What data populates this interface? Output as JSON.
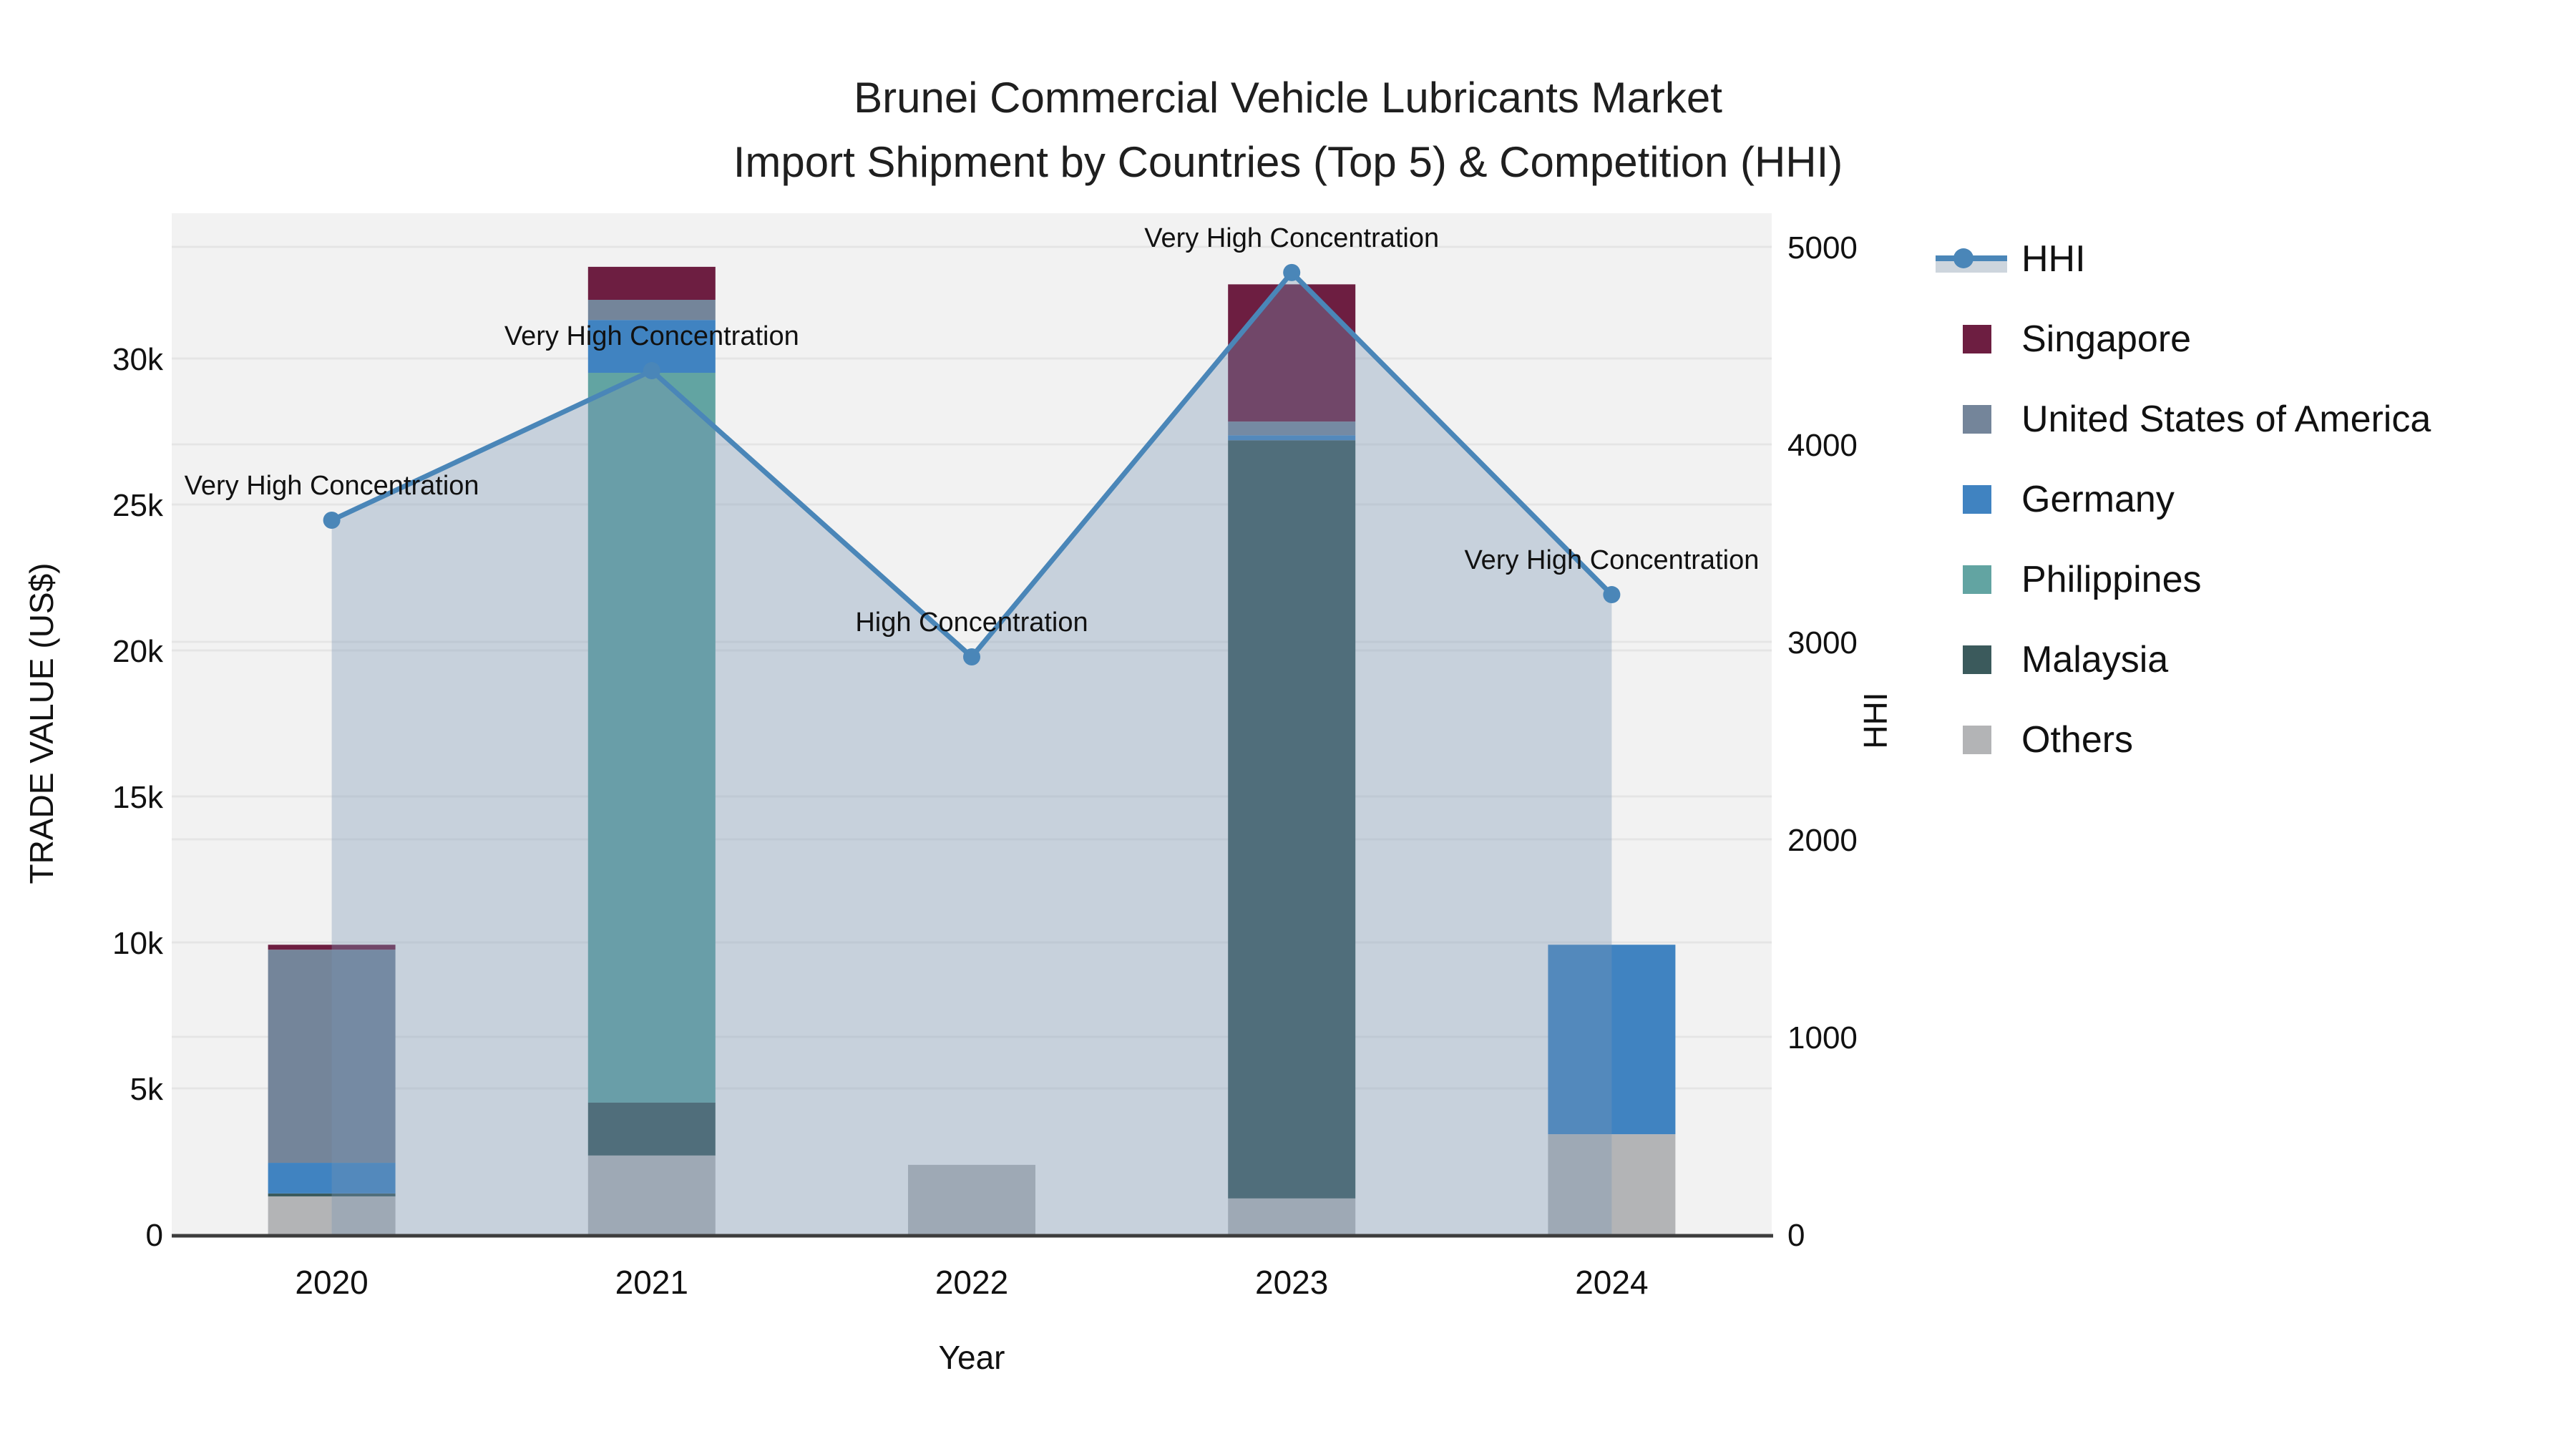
{
  "title": {
    "line1": "Brunei Commercial Vehicle Lubricants Market",
    "line2": "Import Shipment by Countries (Top 5) & Competition (HHI)"
  },
  "axes": {
    "x_title": "Year",
    "y_left_title": "TRADE VALUE (US$)",
    "y_right_title": "HHI",
    "x_tick_labels": [
      "2020",
      "2021",
      "2022",
      "2023",
      "2024"
    ],
    "y_left_tick_labels": [
      "0",
      "5k",
      "10k",
      "15k",
      "20k",
      "25k",
      "30k"
    ],
    "y_left_tick_values": [
      0,
      5000,
      10000,
      15000,
      20000,
      25000,
      30000
    ],
    "y_right_tick_labels": [
      "0",
      "1000",
      "2000",
      "3000",
      "4000",
      "5000"
    ],
    "y_right_tick_values": [
      0,
      1000,
      2000,
      3000,
      4000,
      5000
    ]
  },
  "legend": {
    "items": [
      {
        "label": "HHI",
        "type": "line",
        "color": "#4a86b8"
      },
      {
        "label": "Singapore",
        "type": "swatch",
        "color": "#6d1e41"
      },
      {
        "label": "United States of America",
        "type": "swatch",
        "color": "#74859a"
      },
      {
        "label": "Germany",
        "type": "swatch",
        "color": "#4083c1"
      },
      {
        "label": "Philippines",
        "type": "swatch",
        "color": "#62a4a2"
      },
      {
        "label": "Malaysia",
        "type": "swatch",
        "color": "#3b5a5c"
      },
      {
        "label": "Others",
        "type": "swatch",
        "color": "#b3b4b6"
      }
    ]
  },
  "chart_data": {
    "type": "bar+line",
    "title": "Brunei Commercial Vehicle Lubricants Market — Import Shipment by Countries (Top 5) & Competition (HHI)",
    "categories": [
      "2020",
      "2021",
      "2022",
      "2023",
      "2024"
    ],
    "stack_bottom_to_top": [
      "Others",
      "Malaysia",
      "Philippines",
      "Germany",
      "United States of America",
      "Singapore"
    ],
    "series": [
      {
        "name": "Singapore",
        "type": "bar",
        "color": "#6d1e41",
        "values": [
          170,
          1130,
          0,
          4700,
          0
        ]
      },
      {
        "name": "United States of America",
        "type": "bar",
        "color": "#74859a",
        "values": [
          7300,
          690,
          0,
          470,
          0
        ]
      },
      {
        "name": "Germany",
        "type": "bar",
        "color": "#4083c1",
        "values": [
          1050,
          1810,
          0,
          170,
          6490
        ]
      },
      {
        "name": "Philippines",
        "type": "bar",
        "color": "#62a4a2",
        "values": [
          0,
          25000,
          0,
          0,
          0
        ]
      },
      {
        "name": "Malaysia",
        "type": "bar",
        "color": "#3b5a5c",
        "values": [
          100,
          1810,
          0,
          25970,
          0
        ]
      },
      {
        "name": "Others",
        "type": "bar",
        "color": "#b3b4b6",
        "values": [
          1300,
          2700,
          2380,
          1230,
          3430
        ]
      }
    ],
    "bar_totals": [
      9920,
      33140,
      2380,
      32540,
      9920
    ],
    "line_series": {
      "name": "HHI",
      "type": "line",
      "color": "#4a86b8",
      "area_fill": "rgba(120,150,180,0.35)",
      "values": [
        3616,
        4373,
        2924,
        4870,
        3239
      ]
    },
    "annotations": [
      {
        "x": "2020",
        "text": "Very High Concentration"
      },
      {
        "x": "2021",
        "text": "Very High Concentration"
      },
      {
        "x": "2022",
        "text": "High Concentration"
      },
      {
        "x": "2023",
        "text": "Very High Concentration"
      },
      {
        "x": "2024",
        "text": "Very High Concentration"
      }
    ],
    "xlabel": "Year",
    "ylabel_left": "TRADE VALUE (US$)",
    "ylabel_right": "HHI",
    "y_left_range": [
      0,
      35000
    ],
    "y_right_range": [
      0,
      5000
    ],
    "grid": true,
    "legend_position": "right",
    "plot_bg": "#f2f2f2",
    "grid_color": "#e5e5e5"
  }
}
